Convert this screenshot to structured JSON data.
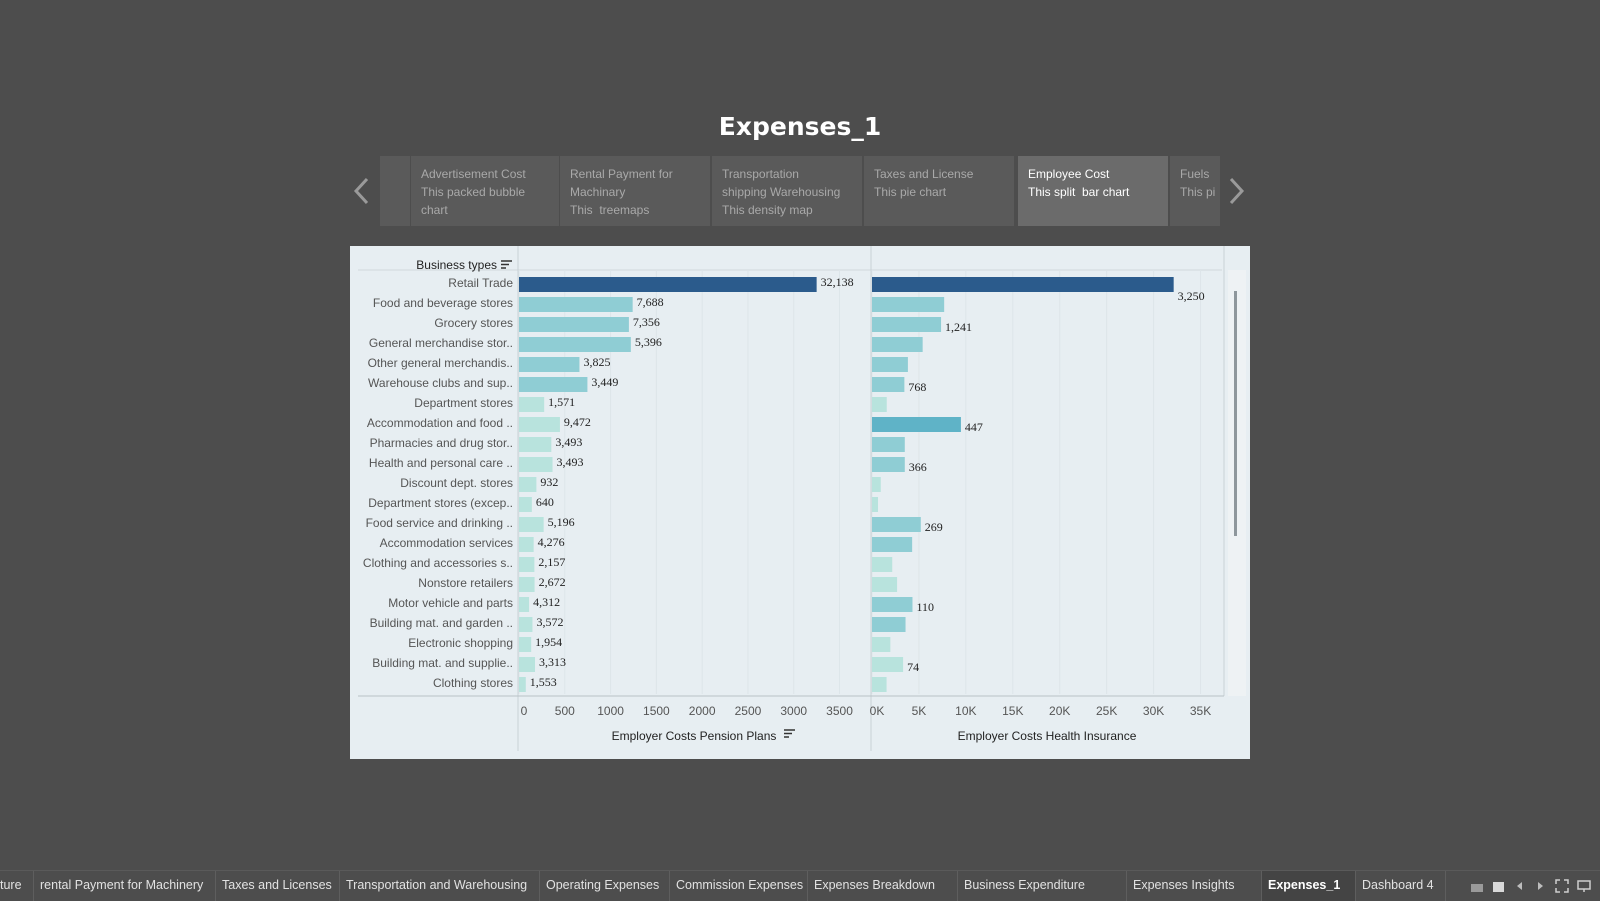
{
  "title": "Expenses_1",
  "story_points": [
    {
      "line1": "",
      "line2": "",
      "line3": ""
    },
    {
      "line1": "Advertisement Cost",
      "line2": "This packed bubble",
      "line3": "chart"
    },
    {
      "line1": "Rental Payment for",
      "line2": "Machinary",
      "line3": "This  treemaps"
    },
    {
      "line1": "Transportation",
      "line2": "shipping Warehousing",
      "line3": "This density map"
    },
    {
      "line1": "Taxes and License",
      "line2": "This pie chart",
      "line3": ""
    },
    {
      "line1": "Employee Cost",
      "line2": "This split  bar chart",
      "line3": ""
    },
    {
      "line1": "Fuels",
      "line2": "This pi",
      "line3": ""
    }
  ],
  "active_story_point": 5,
  "chart_data": {
    "type": "bar",
    "orientation": "horizontal",
    "row_header": "Business types",
    "categories": [
      "Retail Trade",
      "Food and beverage stores",
      "Grocery stores",
      "General merchandise stor..",
      "Other general merchandis..",
      "Warehouse clubs and sup..",
      "Department stores",
      "Accommodation and food ..",
      "Pharmacies and drug stor..",
      "Health and personal care ..",
      "Discount dept. stores",
      "Department stores (excep..",
      "Food service and drinking ..",
      "Accommodation services",
      "Clothing and accessories s..",
      "Nonstore retailers",
      "Motor vehicle and parts",
      "Building mat. and garden ..",
      "Electronic shopping",
      "Building mat. and supplie..",
      "Clothing stores"
    ],
    "series": [
      {
        "name": "Employer Costs Pension Plans",
        "values": [
          3250,
          1241,
          1200,
          1221,
          660,
          747,
          275,
          447,
          353,
          366,
          190,
          140,
          269,
          160,
          168,
          170,
          110,
          147,
          133,
          175,
          74
        ],
        "data_labels": [
          "32,138",
          "7,688",
          "7,356",
          "5,396",
          "3,825",
          "3,449",
          "1,571",
          "9,472",
          "3,493",
          "3,493",
          "932",
          "640",
          "5,196",
          "4,276",
          "2,157",
          "2,672",
          "4,312",
          "3,572",
          "1,954",
          "3,313",
          "1,553"
        ],
        "xlim": [
          0,
          3800
        ],
        "ticks": [
          "0",
          "500",
          "1000",
          "1500",
          "2000",
          "2500",
          "3000",
          "3500"
        ],
        "tick_values": [
          0,
          500,
          1000,
          1500,
          2000,
          2500,
          3000,
          3500
        ]
      },
      {
        "name": "Employer Costs Health Insurance",
        "values": [
          32138,
          7688,
          7356,
          5396,
          3825,
          3449,
          1571,
          9472,
          3493,
          3493,
          932,
          640,
          5196,
          4276,
          2157,
          2672,
          4312,
          3572,
          1954,
          3313,
          1553
        ],
        "data_labels": [
          "3,250",
          "",
          "1,241",
          "",
          "",
          "768",
          "",
          "447",
          "",
          "366",
          "",
          "",
          "269",
          "",
          "",
          "",
          "110",
          "",
          "",
          "74",
          ""
        ],
        "xlim": [
          0,
          37500
        ],
        "ticks": [
          "0K",
          "5K",
          "10K",
          "15K",
          "20K",
          "25K",
          "30K",
          "35K"
        ],
        "tick_values": [
          0,
          5000,
          10000,
          15000,
          20000,
          25000,
          30000,
          35000
        ]
      }
    ],
    "colors": {
      "highlight": "#2b5b8c",
      "dark": "#5fb3c7",
      "mid": "#8fcdd4",
      "light": "#b8e3dd"
    }
  },
  "bottom_tabs": [
    "ture",
    "rental Payment for Machinery",
    "Taxes and Licenses",
    "Transportation and Warehousing",
    "Operating Expenses",
    "Commission Expenses",
    "Expenses Breakdown",
    "Business Expenditure",
    "Expenses Insights",
    "Expenses_1",
    "Dashboard 4"
  ],
  "active_bottom_tab": 9
}
